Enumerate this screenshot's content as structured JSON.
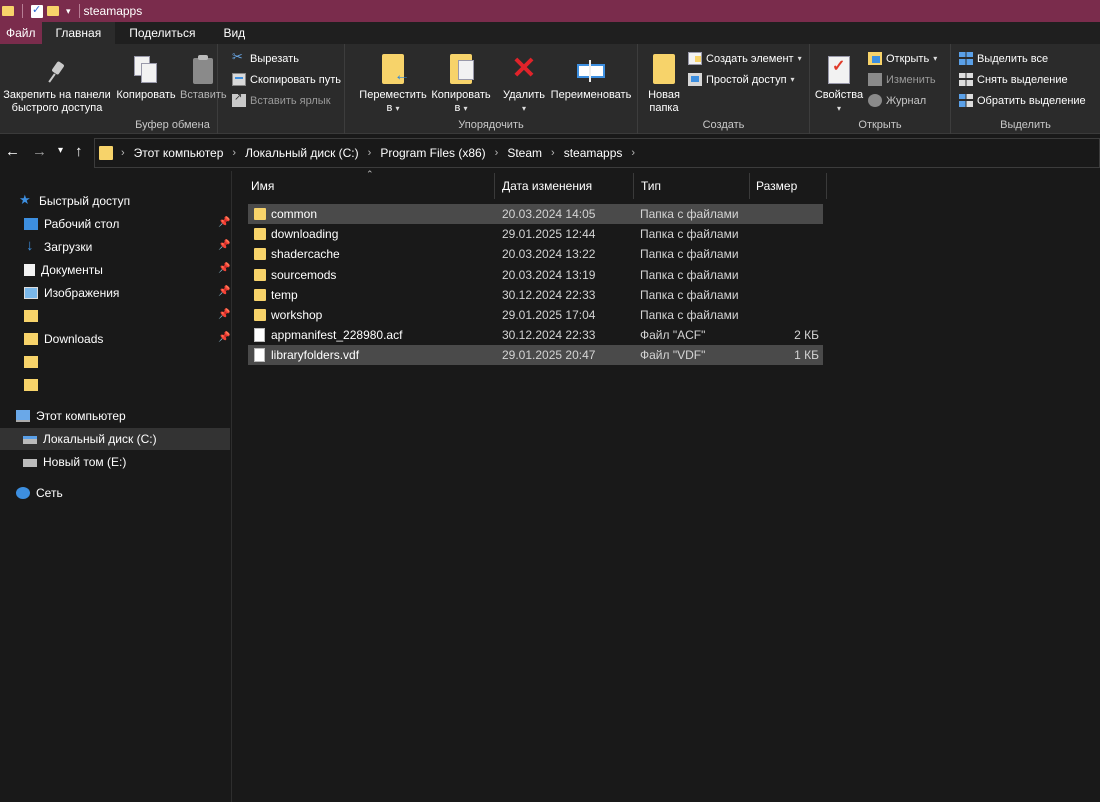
{
  "window": {
    "title": "steamapps"
  },
  "tabs": [
    "Файл",
    "Главная",
    "Поделиться",
    "Вид"
  ],
  "ribbon": {
    "clipboard": {
      "label": "Буфер обмена",
      "pin_line1": "Закрепить на панели",
      "pin_line2": "быстрого доступа",
      "copy": "Копировать",
      "paste": "Вставить",
      "cut": "Вырезать",
      "copy_path": "Скопировать путь",
      "paste_shortcut": "Вставить ярлык"
    },
    "organize": {
      "label": "Упорядочить",
      "move_line1": "Переместить",
      "move_line2": "в",
      "copy_line1": "Копировать",
      "copy_line2": "в",
      "delete": "Удалить",
      "rename": "Переименовать"
    },
    "new": {
      "label": "Создать",
      "folder_line1": "Новая",
      "folder_line2": "папка",
      "new_item": "Создать элемент",
      "easy_access": "Простой доступ"
    },
    "open": {
      "label": "Открыть",
      "properties": "Свойства",
      "open": "Открыть",
      "edit": "Изменить",
      "history": "Журнал"
    },
    "select": {
      "label": "Выделить",
      "select_all": "Выделить все",
      "select_none": "Снять выделение",
      "invert": "Обратить выделение"
    }
  },
  "address": {
    "crumbs": [
      "Этот компьютер",
      "Локальный диск (C:)",
      "Program Files (x86)",
      "Steam",
      "steamapps"
    ]
  },
  "sidebar": {
    "quick_access": "Быстрый доступ",
    "desktop": "Рабочий стол",
    "downloads": "Загрузки",
    "documents": "Документы",
    "images": "Изображения",
    "downloads_folder": "Downloads",
    "this_pc": "Этот компьютер",
    "local_disk": "Локальный диск (C:)",
    "new_volume": "Новый том (E:)",
    "network": "Сеть"
  },
  "columns": {
    "name": "Имя",
    "date": "Дата изменения",
    "type": "Тип",
    "size": "Размер"
  },
  "files": [
    {
      "name": "common",
      "date": "20.03.2024 14:05",
      "type": "Папка с файлами",
      "size": "",
      "kind": "folder",
      "selected": true
    },
    {
      "name": "downloading",
      "date": "29.01.2025 12:44",
      "type": "Папка с файлами",
      "size": "",
      "kind": "folder",
      "selected": false
    },
    {
      "name": "shadercache",
      "date": "20.03.2024 13:22",
      "type": "Папка с файлами",
      "size": "",
      "kind": "folder",
      "selected": false
    },
    {
      "name": "sourcemods",
      "date": "20.03.2024 13:19",
      "type": "Папка с файлами",
      "size": "",
      "kind": "folder",
      "selected": false
    },
    {
      "name": "temp",
      "date": "30.12.2024 22:33",
      "type": "Папка с файлами",
      "size": "",
      "kind": "folder",
      "selected": false
    },
    {
      "name": "workshop",
      "date": "29.01.2025 17:04",
      "type": "Папка с файлами",
      "size": "",
      "kind": "folder",
      "selected": false
    },
    {
      "name": "appmanifest_228980.acf",
      "date": "30.12.2024 22:33",
      "type": "Файл \"ACF\"",
      "size": "2 КБ",
      "kind": "file",
      "selected": false
    },
    {
      "name": "libraryfolders.vdf",
      "date": "29.01.2025 20:47",
      "type": "Файл \"VDF\"",
      "size": "1 КБ",
      "kind": "file",
      "selected": true
    }
  ]
}
